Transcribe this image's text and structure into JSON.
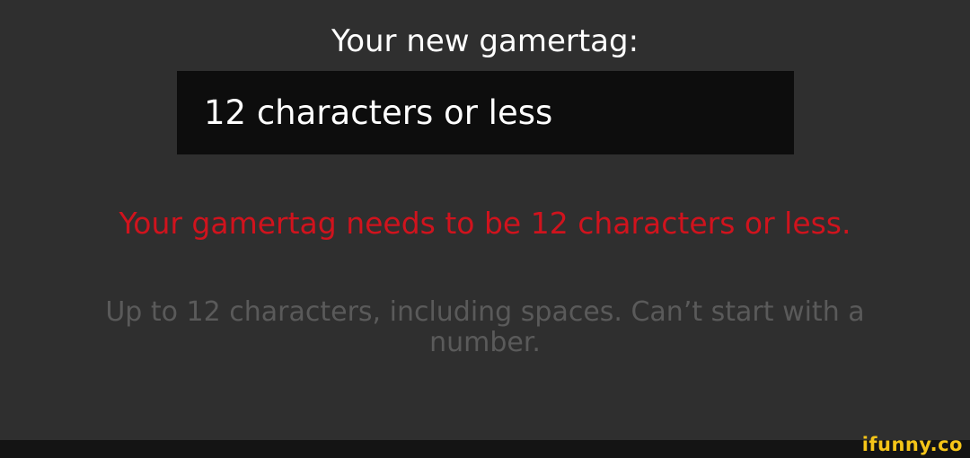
{
  "dialog": {
    "prompt_label": "Your new gamertag:",
    "gamertag_value": "12 characters or less",
    "error_message": "Your gamertag needs to be 12 characters or less.",
    "hint_text": "Up to 12 characters, including spaces. Can’t start with a number."
  },
  "watermark": {
    "text": "ifunny.co"
  },
  "colors": {
    "background": "#2f2f2f",
    "field_background": "#0d0d0d",
    "error": "#d0131d",
    "hint": "#5a5a5a",
    "watermark": "#f5c518"
  }
}
